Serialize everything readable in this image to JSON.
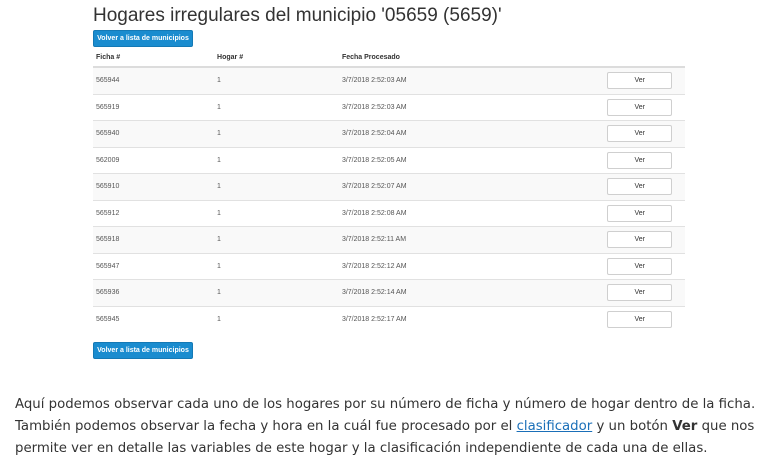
{
  "page": {
    "title": "Hogares irregulares del municipio '05659 (5659)'",
    "back_button_label": "Volver a lista de municipios"
  },
  "table": {
    "headers": [
      "Ficha #",
      "Hogar #",
      "Fecha Procesado",
      ""
    ],
    "action_label": "Ver",
    "rows": [
      {
        "ficha": "565944",
        "hogar": "1",
        "fecha": "3/7/2018 2:52:03 AM"
      },
      {
        "ficha": "565919",
        "hogar": "1",
        "fecha": "3/7/2018 2:52:03 AM"
      },
      {
        "ficha": "565940",
        "hogar": "1",
        "fecha": "3/7/2018 2:52:04 AM"
      },
      {
        "ficha": "562009",
        "hogar": "1",
        "fecha": "3/7/2018 2:52:05 AM"
      },
      {
        "ficha": "565910",
        "hogar": "1",
        "fecha": "3/7/2018 2:52:07 AM"
      },
      {
        "ficha": "565912",
        "hogar": "1",
        "fecha": "3/7/2018 2:52:08 AM"
      },
      {
        "ficha": "565918",
        "hogar": "1",
        "fecha": "3/7/2018 2:52:11 AM"
      },
      {
        "ficha": "565947",
        "hogar": "1",
        "fecha": "3/7/2018 2:52:12 AM"
      },
      {
        "ficha": "565936",
        "hogar": "1",
        "fecha": "3/7/2018 2:52:14 AM"
      },
      {
        "ficha": "565945",
        "hogar": "1",
        "fecha": "3/7/2018 2:52:17 AM"
      }
    ]
  },
  "description": {
    "part1": "Aquí podemos observar cada uno de los hogares por su número de ficha y número de hogar dentro de la ficha. También podemos observar la fecha y hora en la cuál fue procesado por el ",
    "link_text": "clasificador",
    "part2": " y un botón ",
    "bold_text": "Ver",
    "part3": " que nos permite ver en detalle las variables de este hogar y la clasificación independiente de cada una de ellas."
  }
}
